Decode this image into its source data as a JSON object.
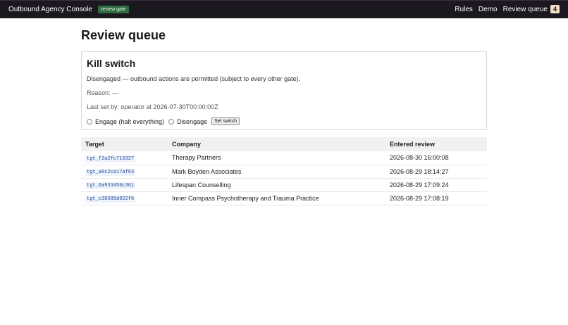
{
  "header": {
    "brand": "Outbound Agency Console",
    "gate_badge": "review gate",
    "nav": {
      "rules": "Rules",
      "demo": "Demo",
      "review_queue": "Review queue",
      "review_count": "4"
    }
  },
  "page": {
    "title": "Review queue"
  },
  "kill_switch": {
    "title": "Kill switch",
    "status": "Disengaged — outbound actions are permitted (subject to every other gate).",
    "reason": "Reason: —",
    "last_set": "Last set by: operator at 2026-07-30T00:00:00Z",
    "engage_label": "Engage (halt everything)",
    "disengage_label": "Disengage",
    "set_button": "Set switch"
  },
  "table": {
    "headers": {
      "target": "Target",
      "company": "Company",
      "entered": "Entered review"
    },
    "rows": [
      {
        "target": "tgt_f2a2fc716327",
        "company": "Therapy Partners",
        "entered": "2026-08-30 16:00:08"
      },
      {
        "target": "tgt_a6c2ca17af83",
        "company": "Mark Boyden Associates",
        "entered": "2026-08-29 18:14:27"
      },
      {
        "target": "tgt_6a933456c361",
        "company": "Lifespan Counselling",
        "entered": "2026-08-29 17:09:24"
      },
      {
        "target": "tgt_c38589d922f6",
        "company": "Inner Compass Psychotherapy and Trauma Practice",
        "entered": "2026-08-29 17:08:19"
      }
    ]
  }
}
